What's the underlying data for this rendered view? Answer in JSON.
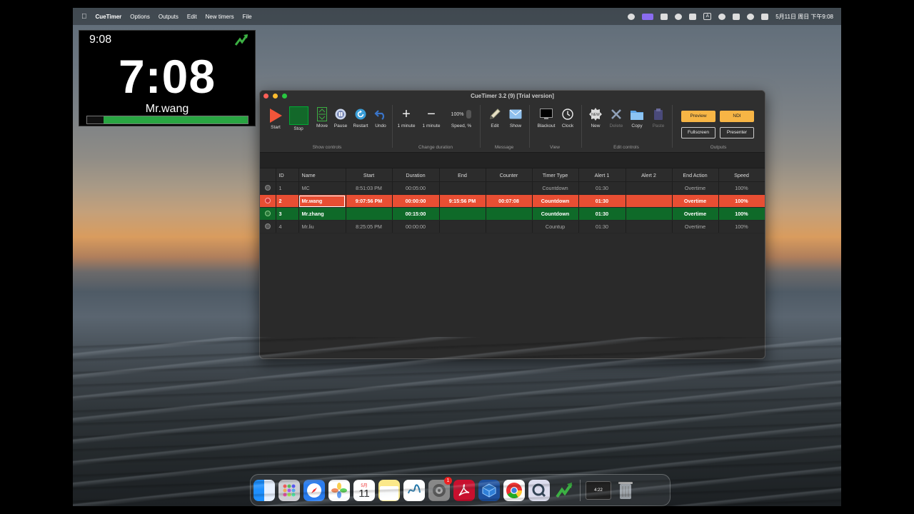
{
  "menubar": {
    "apple": "",
    "app": "CueTimer",
    "items": [
      "Options",
      "Outputs",
      "Edit",
      "New timers",
      "File"
    ],
    "status_a": "A",
    "clock": "5月11日 周日 下午9:08"
  },
  "timer_output": {
    "time_of_day": "9:08",
    "countdown": "7:08",
    "name": "Mr.wang",
    "progress": 0.9
  },
  "window": {
    "title": "CueTimer 3.2 (9) [Trial version]",
    "show_controls": {
      "caption": "Show controls",
      "start": "Start",
      "stop": "Stop",
      "move": "Move",
      "pause": "Pause",
      "restart": "Restart",
      "undo": "Undo"
    },
    "change_duration": {
      "caption": "Change duration",
      "plus": "1 minute",
      "minus": "1 minute",
      "speed_value": "100%",
      "speed_label": "Speed, %"
    },
    "message": {
      "caption": "Message",
      "edit": "Edit",
      "show": "Show"
    },
    "view": {
      "caption": "View",
      "blackout": "Blackout",
      "clock": "Clock"
    },
    "edit_controls": {
      "caption": "Edit controls",
      "new": "New",
      "delete": "Delete",
      "copy": "Copy",
      "paste": "Paste"
    },
    "outputs": {
      "caption": "Outputs",
      "preview": "Preview",
      "ndi": "NDI",
      "fullscreen": "Fullscreen",
      "presenter": "Presenter"
    }
  },
  "table": {
    "headers": [
      "",
      "ID",
      "Name",
      "Start",
      "Duration",
      "End",
      "Counter",
      "Timer Type",
      "Alert 1",
      "Alert 2",
      "End Action",
      "Speed"
    ],
    "rows": [
      [
        "",
        "1",
        "MC",
        "8:51:03 PM",
        "00:05:00",
        "",
        "",
        "Countdown",
        "01:30",
        "",
        "Overtime",
        "100%"
      ],
      [
        "",
        "2",
        "Mr.wang",
        "9:07:56 PM",
        "00:00:00",
        "9:15:56 PM",
        "00:07:08",
        "Countdown",
        "01:30",
        "",
        "Overtime",
        "100%"
      ],
      [
        "",
        "3",
        "Mr.zhang",
        "",
        "00:15:00",
        "",
        "",
        "Countdown",
        "01:30",
        "",
        "Overtime",
        "100%"
      ],
      [
        "",
        "4",
        "Mr.liu",
        "8:25:05 PM",
        "00:00:00",
        "",
        "",
        "Countup",
        "01:30",
        "",
        "Overtime",
        "100%"
      ]
    ]
  },
  "dock": {
    "calendar_month": "5月",
    "calendar_day": "11",
    "settings_badge": "1",
    "app_time": "4:22"
  },
  "colors": {
    "running_row": "#e84e33",
    "next_row": "#0f6a29",
    "output_button": "#f7b545",
    "progress_fill": "#29a542"
  }
}
